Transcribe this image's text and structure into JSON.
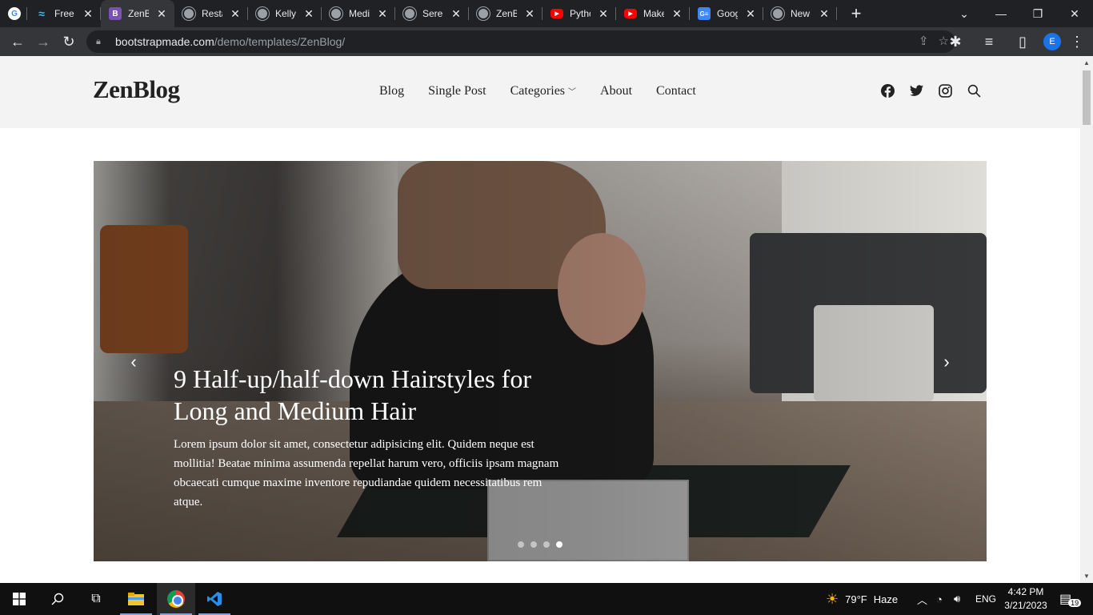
{
  "browser": {
    "tabs": [
      {
        "icon": "google-icon",
        "title": ""
      },
      {
        "icon": "tailwind-icon",
        "title": "Free B"
      },
      {
        "icon": "bootstrap-icon",
        "title": "ZenBl",
        "active": true
      },
      {
        "icon": "globe-icon",
        "title": "Resta"
      },
      {
        "icon": "globe-icon",
        "title": "Kelly E"
      },
      {
        "icon": "globe-icon",
        "title": "Medic"
      },
      {
        "icon": "globe-icon",
        "title": "Seren"
      },
      {
        "icon": "globe-icon",
        "title": "ZenBl"
      },
      {
        "icon": "youtube-icon",
        "title": "Pytho"
      },
      {
        "icon": "youtube-icon",
        "title": "Make"
      },
      {
        "icon": "sheets-icon",
        "title": "Googl"
      },
      {
        "icon": "globe-icon",
        "title": "New T"
      }
    ],
    "url_host": "bootstrapmade.com",
    "url_path": "/demo/templates/ZenBlog/",
    "profile_initial": "E"
  },
  "site": {
    "logo": "ZenBlog",
    "nav": [
      "Blog",
      "Single Post",
      "Categories",
      "About",
      "Contact"
    ],
    "social_icons": [
      "facebook-icon",
      "twitter-icon",
      "instagram-icon",
      "search-icon"
    ]
  },
  "hero": {
    "title": "9 Half-up/half-down Hairstyles for Long and Medium Hair",
    "excerpt": "Lorem ipsum dolor sit amet, consectetur adipisicing elit. Quidem neque est mollitia! Beatae minima assumenda repellat harum vero, officiis ipsam magnam obcaecati cumque maxime inventore repudiandae quidem necessitatibus rem atque.",
    "slide_count": 4,
    "active_slide": 4
  },
  "taskbar": {
    "weather_temp": "79°F",
    "weather_desc": "Haze",
    "language": "ENG",
    "time": "4:42 PM",
    "date": "3/21/2023",
    "notification_count": "19"
  }
}
